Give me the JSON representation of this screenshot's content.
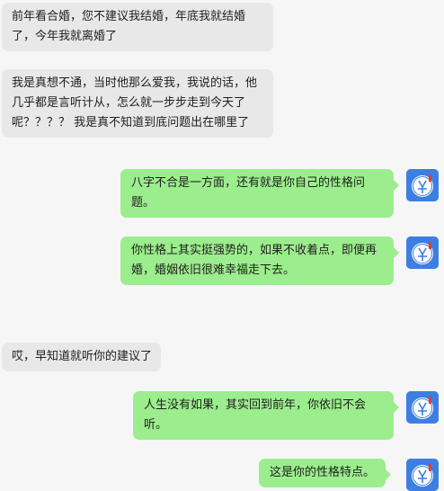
{
  "chat": {
    "messages": [
      {
        "from": "other",
        "text": "前年看合婚，您不建议我结婚，年底我就结婚了，今年我就离婚了"
      },
      {
        "from": "other",
        "text": "我是真想不通，当时他那么爱我，我说的话，他几乎都是言听计从，怎么就一步步走到今天了呢？？？？ 我是真不知道到底问题出在哪里了"
      },
      {
        "from": "self",
        "text": "八字不合是一方面，还有就是你自己的性格问题。"
      },
      {
        "from": "self",
        "text": "你性格上其实挺强势的，如果不收着点，即便再婚，婚姻依旧很难幸福走下去。"
      },
      {
        "from": "other",
        "text": "哎，早知道就听你的建议了"
      },
      {
        "from": "self",
        "text": "人生没有如果，其实回到前年，你依旧不会听。"
      },
      {
        "from": "self",
        "text": "这是你的性格特点。"
      }
    ]
  },
  "colors": {
    "background": "#f6f6f6",
    "incoming_bubble": "#e8e8e8",
    "outgoing_bubble": "#9ced8d",
    "avatar_bg": "#3d7fe0"
  },
  "icons": {
    "self_avatar": "avatar-icon"
  }
}
